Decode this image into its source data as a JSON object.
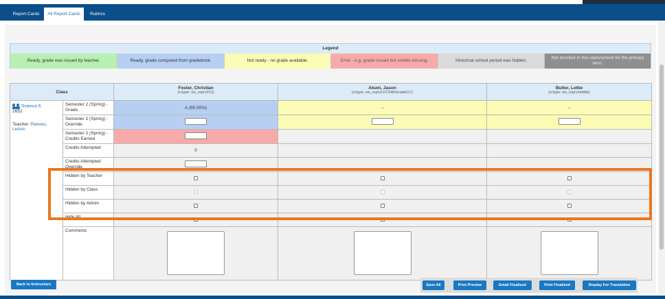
{
  "tabs": [
    {
      "label": "Report Cards"
    },
    {
      "label": "All Report Cards"
    },
    {
      "label": "Rubrics"
    }
  ],
  "legend": {
    "title": "Legend",
    "items": [
      {
        "label": "Ready, grade was issued by teacher.",
        "color": "#b7f0b1"
      },
      {
        "label": "Ready, grade computed from gradebook.",
        "color": "#b6cff3"
      },
      {
        "label": "Not ready - no grade available.",
        "color": "#fbfbb4"
      },
      {
        "label": "Error - e.g. grade issued but credits missing.",
        "color": "#f8aaaa"
      },
      {
        "label": "Historical school period was hidden.",
        "color": "#dadada"
      },
      {
        "label": "Not enrolled in this class/school for the primary term.",
        "color": "#8f8f8f"
      }
    ]
  },
  "grid": {
    "class_header": "Class",
    "class": {
      "name": "Science 6",
      "id": "2652",
      "teacher_label": "Teacher:",
      "teacher_name": "Reeves, LeAnn"
    },
    "students": [
      {
        "name": "Foster, Christian",
        "rctype": "(rctype: sis_reprc912)",
        "grade": "A (95.00%)",
        "credits_attempted": "0"
      },
      {
        "name": "Akuni, Jason",
        "rctype": "(rctype: sis_reprcLVCS4thGradeCC)",
        "grade": "--",
        "credits_attempted": ""
      },
      {
        "name": "Butler, Lettie",
        "rctype": "(rctype: sis_reprcmiddle)",
        "grade": "--",
        "credits_attempted": ""
      }
    ],
    "rows": {
      "grade": "Semester 2 (Spring) - Grade",
      "override": "Semester 2 (Spring) - Override",
      "credits_earned": "Semester 2 (Spring) - Credits Earned",
      "credits_attempted": "Credits Attempted",
      "credits_attempted_override": "Credits Attempted Override",
      "hidden_teacher": "Hidden by Teacher",
      "hidden_class": "Hidden by Class",
      "hidden_admin": "Hidden by Admin",
      "hide_all": "Hide All",
      "comments": "Comments"
    }
  },
  "buttons": {
    "back": "Back to Instructors",
    "save_all": "Save All",
    "print_preview": "Print Preview",
    "email_finalized": "Email Finalized",
    "print_finalized": "Print Finalized",
    "display_translation": "Display For Translation"
  },
  "icons": {
    "class_icon": "group-icon"
  },
  "colors": {
    "accent": "#0b4f8a",
    "button": "#1a78c2",
    "highlight": "#e87722"
  }
}
